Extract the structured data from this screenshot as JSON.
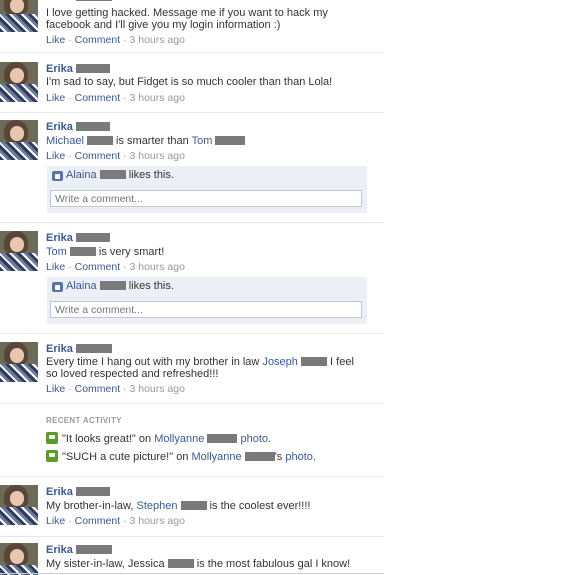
{
  "author": "Erika",
  "actions": {
    "like": "Like",
    "comment": "Comment",
    "sep": "·",
    "time": "3 hours ago"
  },
  "comment_placeholder": "Write a comment...",
  "stories": [
    {
      "text": "I love getting hacked. Message me if you want to hack my facebook and I'll give you my login information :)"
    },
    {
      "text": "I'm sad to say, but Fidget is so much cooler than than Lola!"
    },
    {
      "mention": "Michael",
      "text_mid": " is smarter than ",
      "mention2": "Tom",
      "liked_by": "Alaina",
      "likes_suffix": " likes this."
    },
    {
      "mention": "Tom",
      "text_mid": " is very smart!",
      "liked_by": "Alaina",
      "likes_suffix": " likes this."
    },
    {
      "text_pre": "Every time I hang out with my brother in law ",
      "mention": "Joseph",
      "text_post": " I feel so loved respected and refreshed!!!"
    },
    {
      "text_pre": "My brother-in-law, ",
      "mention": "Stephen",
      "text_post": " is the coolest ever!!!!"
    },
    {
      "text_pre": "My sister-in-law, Jessica ",
      "text_post": " is the most fabulous gal I know!"
    }
  ],
  "recent_activity": {
    "title": "RECENT ACTIVITY",
    "items": [
      {
        "quote": "\"It looks great!\"",
        "on": " on ",
        "person": "Mollyanne",
        "suffix": "",
        "target": "photo."
      },
      {
        "quote": "\"SUCH a cute picture!\"",
        "on": " on ",
        "person": "Mollyanne",
        "suffix": "'s ",
        "target": "photo."
      }
    ]
  }
}
